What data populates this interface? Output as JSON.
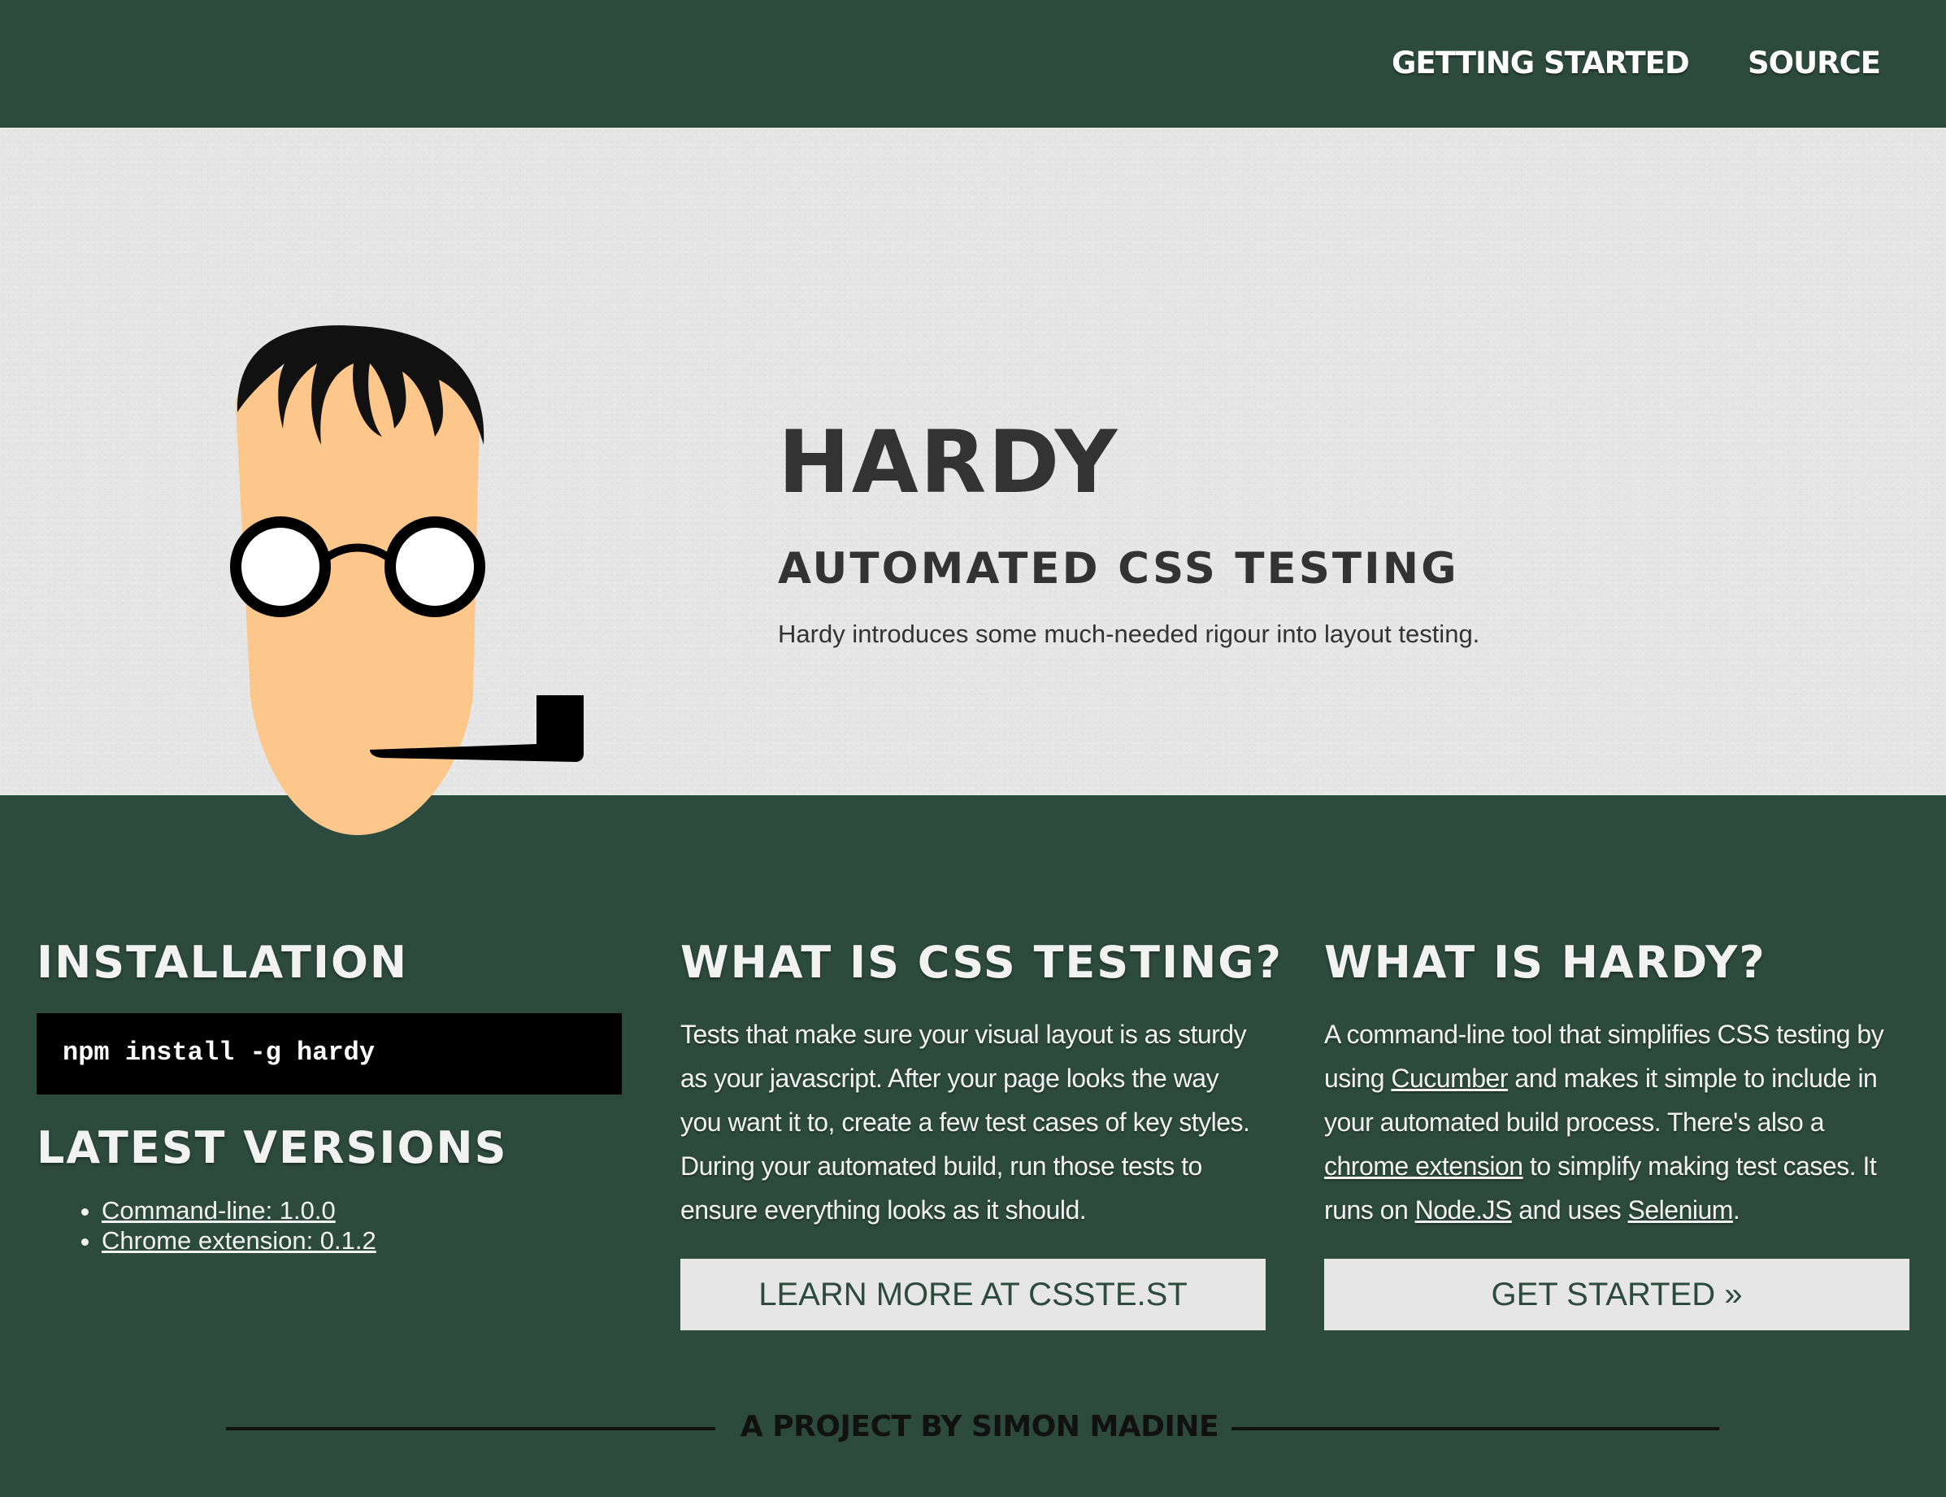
{
  "nav": {
    "getting_started": "GETTING STARTED",
    "source": "SOURCE"
  },
  "hero": {
    "title": "HARDY",
    "subtitle": "AUTOMATED CSS TESTING",
    "lead": "Hardy introduces some much-needed rigour into layout testing."
  },
  "installation": {
    "heading": "INSTALLATION",
    "command": "npm install -g hardy"
  },
  "latest_versions": {
    "heading": "LATEST VERSIONS",
    "items": [
      "Command-line: 1.0.0",
      "Chrome extension: 0.1.2"
    ]
  },
  "css_testing": {
    "heading": "WHAT IS CSS TESTING?",
    "body": "Tests that make sure your visual layout is as sturdy as your javascript. After your page looks the way you want it to, create a few test cases of key styles. During your automated build, run those tests to ensure everything looks as it should.",
    "button": "LEARN MORE AT CSSTE.ST"
  },
  "what_is_hardy": {
    "heading": "WHAT IS HARDY?",
    "text_1": "A command-line tool that simplifies CSS testing by using ",
    "link_cucumber": "Cucumber",
    "text_2": " and makes it simple to include in your automated build process. There's also a ",
    "link_chrome": "chrome extension",
    "text_3": " to simplify making test cases. It runs on ",
    "link_node": "Node.JS",
    "text_4": " and uses ",
    "link_selenium": "Selenium",
    "text_5": ".",
    "button": "GET STARTED »"
  },
  "footer": {
    "text": "A PROJECT BY SIMON MADINE"
  },
  "colors": {
    "dark_green": "#2d4a3e",
    "hero_bg": "#e6e6e6",
    "text_dark": "#333333",
    "skin": "#fdc78c"
  }
}
